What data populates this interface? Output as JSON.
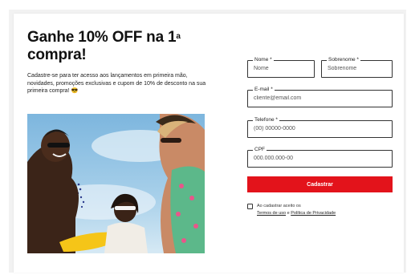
{
  "header": {
    "title_main": "Ganhe 10% OFF na 1",
    "title_sup": "a",
    "title_end": "compra!"
  },
  "description": "Cadastre-se para ter acesso aos lançamentos em primeira mão, novidades, promoções exclusivas e cupom de 10% de desconto na sua primeira compra! 😎",
  "form": {
    "nome": {
      "label": "Nome *",
      "placeholder": "Nome"
    },
    "sobrenome": {
      "label": "Sobrenome *",
      "placeholder": "Sobrenome"
    },
    "email": {
      "label": "E-mail *",
      "placeholder": "cliente@email.com"
    },
    "telefone": {
      "label": "Telefone *",
      "placeholder": "(00) 00000-0000"
    },
    "cpf": {
      "label": "CPF",
      "placeholder": "000.000.000-00"
    },
    "submit_label": "Cadastrar",
    "consent": {
      "prefix": "Ao cadastrar aceito os",
      "terms_link": "Termos de uso",
      "and": "e",
      "privacy_link": "Política de Privacidade"
    }
  },
  "colors": {
    "accent": "#e3131b"
  }
}
